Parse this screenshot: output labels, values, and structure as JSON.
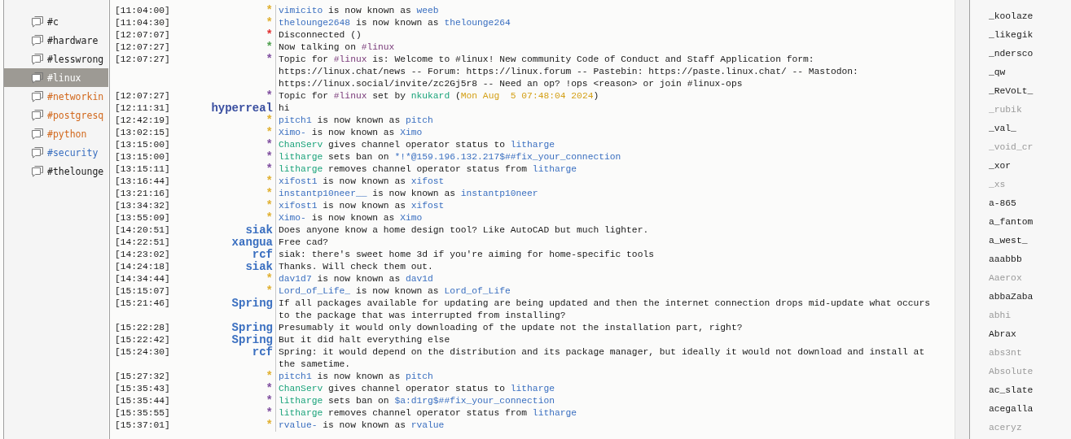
{
  "channels": [
    {
      "name": "#c",
      "selected": false,
      "color": "#1a1a1a"
    },
    {
      "name": "#hardware",
      "selected": false,
      "color": "#1a1a1a"
    },
    {
      "name": "#lesswrong",
      "selected": false,
      "color": "#1a1a1a"
    },
    {
      "name": "#linux",
      "selected": true,
      "color": "#ffffff"
    },
    {
      "name": "#networkin",
      "selected": false,
      "color": "#d2691e"
    },
    {
      "name": "#postgresq",
      "selected": false,
      "color": "#d2691e"
    },
    {
      "name": "#python",
      "selected": false,
      "color": "#d2691e"
    },
    {
      "name": "#security",
      "selected": false,
      "color": "#3a6fc0"
    },
    {
      "name": "#thelounge",
      "selected": false,
      "color": "#1a1a1a"
    }
  ],
  "messages": [
    {
      "time": "[11:04:00]",
      "nick": "*",
      "color": "#e0b030",
      "lines": [
        [
          {
            "text": "vimicito",
            "kind": "nick"
          },
          {
            "text": " is now known as ",
            "kind": "text"
          },
          {
            "text": "weeb",
            "kind": "nick"
          }
        ]
      ]
    },
    {
      "time": "[11:04:30]",
      "nick": "*",
      "color": "#e0b030",
      "lines": [
        [
          {
            "text": "thelounge2648",
            "kind": "nick"
          },
          {
            "text": " is now known as ",
            "kind": "text"
          },
          {
            "text": "thelounge264",
            "kind": "nick"
          }
        ]
      ]
    },
    {
      "time": "[12:07:07]",
      "nick": "*",
      "color": "#e03030",
      "lines": [
        [
          {
            "text": "Disconnected ()",
            "kind": "text"
          }
        ]
      ]
    },
    {
      "time": "[12:07:27]",
      "nick": "*",
      "color": "#50a050",
      "lines": [
        [
          {
            "text": "Now talking on ",
            "kind": "text"
          },
          {
            "text": "#linux",
            "kind": "channel"
          }
        ]
      ]
    },
    {
      "time": "[12:07:27]",
      "nick": "*",
      "color": "#8050a0",
      "lines": [
        [
          {
            "text": "Topic for ",
            "kind": "text"
          },
          {
            "text": "#linux",
            "kind": "channel"
          },
          {
            "text": " is: Welcome to #linux! New community Code of Conduct and Staff Application form:",
            "kind": "text"
          }
        ],
        [
          {
            "text": "https://linux.chat/news -- Forum: https://linux.forum -- Pastebin: https://paste.linux.chat/ -- Mastodon:",
            "kind": "text"
          }
        ],
        [
          {
            "text": "https://linux.social/invite/zc2Gj5r8 -- Need an op? !ops <reason> or join #linux-ops",
            "kind": "text"
          }
        ]
      ]
    },
    {
      "time": "[12:07:27]",
      "nick": "*",
      "color": "#8050a0",
      "lines": [
        [
          {
            "text": "Topic for ",
            "kind": "text"
          },
          {
            "text": "#linux",
            "kind": "channel"
          },
          {
            "text": " set by ",
            "kind": "text"
          },
          {
            "text": "nkukard",
            "kind": "op"
          },
          {
            "text": " (",
            "kind": "text"
          },
          {
            "text": "Mon Aug  5 07:48:04 2024",
            "kind": "date"
          },
          {
            "text": ")",
            "kind": "text"
          }
        ]
      ]
    },
    {
      "time": "[12:11:31]",
      "nick": "hyperreal",
      "color": "#3a4fa0",
      "lines": [
        [
          {
            "text": "hi",
            "kind": "text"
          }
        ]
      ]
    },
    {
      "time": "[12:42:19]",
      "nick": "*",
      "color": "#e0b030",
      "lines": [
        [
          {
            "text": "pitch1",
            "kind": "nick"
          },
          {
            "text": " is now known as ",
            "kind": "text"
          },
          {
            "text": "pitch",
            "kind": "nick"
          }
        ]
      ]
    },
    {
      "time": "[13:02:15]",
      "nick": "*",
      "color": "#e0b030",
      "lines": [
        [
          {
            "text": "Ximo-",
            "kind": "nick"
          },
          {
            "text": " is now known as ",
            "kind": "text"
          },
          {
            "text": "Ximo",
            "kind": "nick"
          }
        ]
      ]
    },
    {
      "time": "[13:15:00]",
      "nick": "*",
      "color": "#8050a0",
      "lines": [
        [
          {
            "text": "ChanServ",
            "kind": "op"
          },
          {
            "text": " gives channel operator status to ",
            "kind": "text"
          },
          {
            "text": "litharge",
            "kind": "nick"
          }
        ]
      ]
    },
    {
      "time": "[13:15:00]",
      "nick": "*",
      "color": "#8050a0",
      "lines": [
        [
          {
            "text": "litharge",
            "kind": "op"
          },
          {
            "text": " sets ban on ",
            "kind": "text"
          },
          {
            "text": "*!*@159.196.132.217$##fix_your_connection",
            "kind": "nick"
          }
        ]
      ]
    },
    {
      "time": "[13:15:11]",
      "nick": "*",
      "color": "#8050a0",
      "lines": [
        [
          {
            "text": "litharge",
            "kind": "op"
          },
          {
            "text": " removes channel operator status from ",
            "kind": "text"
          },
          {
            "text": "litharge",
            "kind": "nick"
          }
        ]
      ]
    },
    {
      "time": "[13:16:44]",
      "nick": "*",
      "color": "#e0b030",
      "lines": [
        [
          {
            "text": "xifost1",
            "kind": "nick"
          },
          {
            "text": " is now known as ",
            "kind": "text"
          },
          {
            "text": "xifost",
            "kind": "nick"
          }
        ]
      ]
    },
    {
      "time": "[13:21:16]",
      "nick": "*",
      "color": "#e0b030",
      "lines": [
        [
          {
            "text": "instantp10neer__",
            "kind": "nick"
          },
          {
            "text": " is now known as ",
            "kind": "text"
          },
          {
            "text": "instantp10neer",
            "kind": "nick"
          }
        ]
      ]
    },
    {
      "time": "[13:34:32]",
      "nick": "*",
      "color": "#e0b030",
      "lines": [
        [
          {
            "text": "xifost1",
            "kind": "nick"
          },
          {
            "text": " is now known as ",
            "kind": "text"
          },
          {
            "text": "xifost",
            "kind": "nick"
          }
        ]
      ]
    },
    {
      "time": "[13:55:09]",
      "nick": "*",
      "color": "#e0b030",
      "lines": [
        [
          {
            "text": "Ximo-",
            "kind": "nick"
          },
          {
            "text": " is now known as ",
            "kind": "text"
          },
          {
            "text": "Ximo",
            "kind": "nick"
          }
        ]
      ]
    },
    {
      "time": "[14:20:51]",
      "nick": "siak",
      "color": "#3a6fc0",
      "lines": [
        [
          {
            "text": "Does anyone know a home design tool? Like AutoCAD but much lighter.",
            "kind": "text"
          }
        ]
      ]
    },
    {
      "time": "[14:22:51]",
      "nick": "xangua",
      "color": "#3a6fc0",
      "lines": [
        [
          {
            "text": "Free cad?",
            "kind": "text"
          }
        ]
      ]
    },
    {
      "time": "[14:23:02]",
      "nick": "rcf",
      "color": "#3a6fc0",
      "lines": [
        [
          {
            "text": "siak: there's sweet home 3d if you're aiming for home-specific tools",
            "kind": "text"
          }
        ]
      ]
    },
    {
      "time": "[14:24:18]",
      "nick": "siak",
      "color": "#3a6fc0",
      "lines": [
        [
          {
            "text": "Thanks. Will check them out.",
            "kind": "text"
          }
        ]
      ]
    },
    {
      "time": "[14:34:44]",
      "nick": "*",
      "color": "#e0b030",
      "lines": [
        [
          {
            "text": "dav1d7",
            "kind": "nick"
          },
          {
            "text": " is now known as ",
            "kind": "text"
          },
          {
            "text": "dav1d",
            "kind": "nick"
          }
        ]
      ]
    },
    {
      "time": "[15:15:07]",
      "nick": "*",
      "color": "#e0b030",
      "lines": [
        [
          {
            "text": "Lord_of_Life_",
            "kind": "nick"
          },
          {
            "text": " is now known as ",
            "kind": "text"
          },
          {
            "text": "Lord_of_Life",
            "kind": "nick"
          }
        ]
      ]
    },
    {
      "time": "[15:21:46]",
      "nick": "Spring",
      "color": "#3a6fc0",
      "lines": [
        [
          {
            "text": "If all packages available for updating are being updated and then the internet connection drops mid-update what occurs",
            "kind": "text"
          }
        ],
        [
          {
            "text": "to the package that was interrupted from installing?",
            "kind": "text"
          }
        ]
      ]
    },
    {
      "time": "[15:22:28]",
      "nick": "Spring",
      "color": "#3a6fc0",
      "lines": [
        [
          {
            "text": "Presumably it would only downloading of the update not the installation part, right?",
            "kind": "text"
          }
        ]
      ]
    },
    {
      "time": "[15:22:42]",
      "nick": "Spring",
      "color": "#3a6fc0",
      "lines": [
        [
          {
            "text": "But it did halt everything else",
            "kind": "text"
          }
        ]
      ]
    },
    {
      "time": "[15:24:30]",
      "nick": "rcf",
      "color": "#3a6fc0",
      "lines": [
        [
          {
            "text": "Spring: it would depend on the distribution and its package manager, but ideally it would not download and install at",
            "kind": "text"
          }
        ],
        [
          {
            "text": "the sametime.",
            "kind": "text"
          }
        ]
      ]
    },
    {
      "time": "[15:27:32]",
      "nick": "*",
      "color": "#e0b030",
      "lines": [
        [
          {
            "text": "pitch1",
            "kind": "nick"
          },
          {
            "text": " is now known as ",
            "kind": "text"
          },
          {
            "text": "pitch",
            "kind": "nick"
          }
        ]
      ]
    },
    {
      "time": "[15:35:43]",
      "nick": "*",
      "color": "#8050a0",
      "lines": [
        [
          {
            "text": "ChanServ",
            "kind": "op"
          },
          {
            "text": " gives channel operator status to ",
            "kind": "text"
          },
          {
            "text": "litharge",
            "kind": "nick"
          }
        ]
      ]
    },
    {
      "time": "[15:35:44]",
      "nick": "*",
      "color": "#8050a0",
      "lines": [
        [
          {
            "text": "litharge",
            "kind": "op"
          },
          {
            "text": " sets ban on ",
            "kind": "text"
          },
          {
            "text": "$a:d1rg$##fix_your_connection",
            "kind": "nick"
          }
        ]
      ]
    },
    {
      "time": "[15:35:55]",
      "nick": "*",
      "color": "#8050a0",
      "lines": [
        [
          {
            "text": "litharge",
            "kind": "op"
          },
          {
            "text": " removes channel operator status from ",
            "kind": "text"
          },
          {
            "text": "litharge",
            "kind": "nick"
          }
        ]
      ]
    },
    {
      "time": "[15:37:01]",
      "nick": "*",
      "color": "#e0b030",
      "lines": [
        [
          {
            "text": "rvalue-",
            "kind": "nick"
          },
          {
            "text": " is now known as ",
            "kind": "text"
          },
          {
            "text": "rvalue",
            "kind": "nick"
          }
        ]
      ]
    }
  ],
  "users": [
    {
      "name": "_koolaze",
      "away": false
    },
    {
      "name": "_likegik",
      "away": false
    },
    {
      "name": "_ndersco",
      "away": false
    },
    {
      "name": "_qw",
      "away": false
    },
    {
      "name": "_ReVoLt_",
      "away": false
    },
    {
      "name": "_rubik",
      "away": true
    },
    {
      "name": "_val_",
      "away": false
    },
    {
      "name": "_void_cr",
      "away": true
    },
    {
      "name": "_xor",
      "away": false
    },
    {
      "name": "_xs",
      "away": true
    },
    {
      "name": "a-865",
      "away": false
    },
    {
      "name": "a_fantom",
      "away": false
    },
    {
      "name": "a_west_",
      "away": false
    },
    {
      "name": "aaabbb",
      "away": false
    },
    {
      "name": "Aaerox",
      "away": true
    },
    {
      "name": "abbaZaba",
      "away": false
    },
    {
      "name": "abhi",
      "away": true
    },
    {
      "name": "Abrax",
      "away": false
    },
    {
      "name": "abs3nt",
      "away": true
    },
    {
      "name": "Absolute",
      "away": true
    },
    {
      "name": "ac_slate",
      "away": false
    },
    {
      "name": "acegalla",
      "away": false
    },
    {
      "name": "aceryz",
      "away": true
    }
  ]
}
